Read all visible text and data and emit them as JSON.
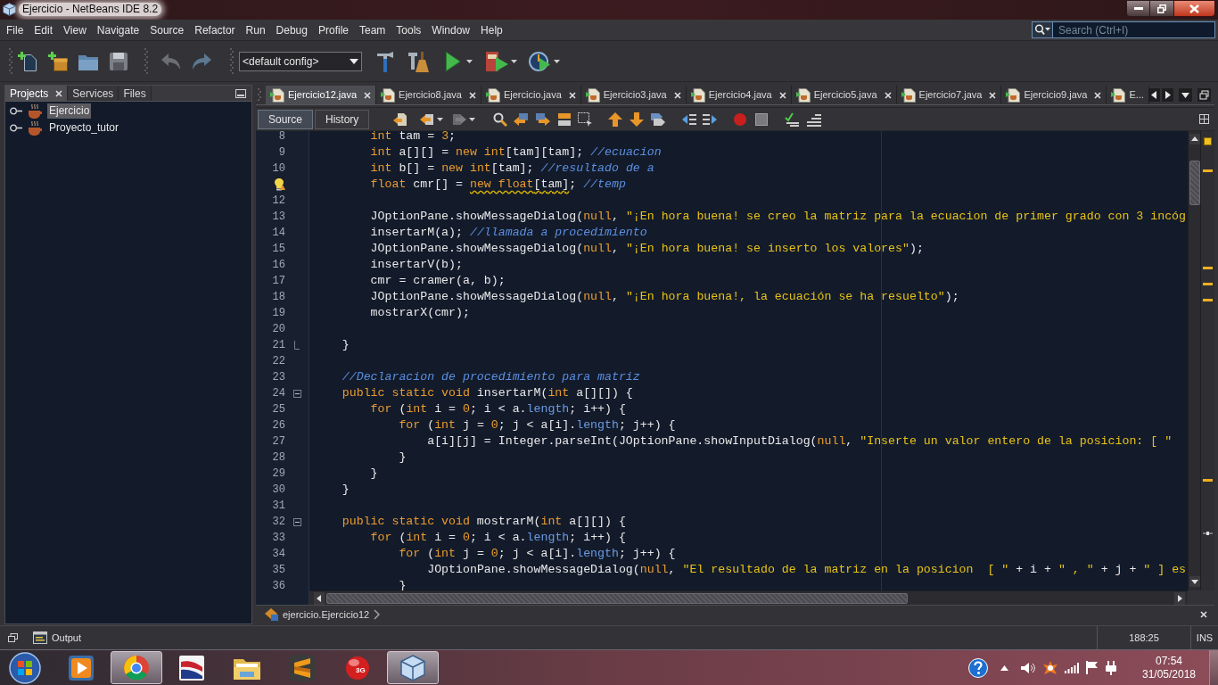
{
  "window": {
    "title": "Ejercicio - NetBeans IDE 8.2"
  },
  "menu_bar": {
    "items": [
      "File",
      "Edit",
      "View",
      "Navigate",
      "Source",
      "Refactor",
      "Run",
      "Debug",
      "Profile",
      "Team",
      "Tools",
      "Window",
      "Help"
    ],
    "search": {
      "placeholder": "Search (Ctrl+I)"
    }
  },
  "toolbar": {
    "config": "<default config>"
  },
  "projects_panel": {
    "tabs": [
      {
        "label": "Projects",
        "selected": true,
        "closable": true
      },
      {
        "label": "Services",
        "selected": false,
        "closable": false
      },
      {
        "label": "Files",
        "selected": false,
        "closable": false
      }
    ],
    "tree": [
      {
        "label": "Ejercicio",
        "selected": true
      },
      {
        "label": "Proyecto_tutor",
        "selected": false
      }
    ]
  },
  "editor": {
    "tabs": [
      {
        "label": "Ejercicio12.java",
        "selected": true,
        "closable": true
      },
      {
        "label": "Ejercicio8.java",
        "selected": false,
        "closable": true
      },
      {
        "label": "Ejercicio.java",
        "selected": false,
        "closable": true
      },
      {
        "label": "Ejercicio3.java",
        "selected": false,
        "closable": true
      },
      {
        "label": "Ejercicio4.java",
        "selected": false,
        "closable": true
      },
      {
        "label": "Ejercicio5.java",
        "selected": false,
        "closable": true
      },
      {
        "label": "Ejercicio7.java",
        "selected": false,
        "closable": true
      },
      {
        "label": "Ejercicio9.java",
        "selected": false,
        "closable": true
      },
      {
        "label": "E...",
        "selected": false,
        "closable": false
      }
    ],
    "views": [
      {
        "label": "Source",
        "selected": true
      },
      {
        "label": "History",
        "selected": false
      }
    ],
    "lines": [
      {
        "number": "8",
        "tokens": [
          {
            "kind": "keyword",
            "text": "        int"
          },
          {
            "kind": "plain",
            "text": " tam = "
          },
          {
            "kind": "number",
            "text": "3"
          },
          {
            "kind": "plain",
            "text": ";"
          }
        ]
      },
      {
        "number": "9",
        "tokens": [
          {
            "kind": "keyword",
            "text": "        int"
          },
          {
            "kind": "plain",
            "text": " a[][] = "
          },
          {
            "kind": "keyword",
            "text": "new int"
          },
          {
            "kind": "plain",
            "text": "[tam][tam]; "
          },
          {
            "kind": "comment",
            "text": "//ecuacion"
          }
        ]
      },
      {
        "number": "10",
        "tokens": [
          {
            "kind": "keyword",
            "text": "        int"
          },
          {
            "kind": "plain",
            "text": " b[] = "
          },
          {
            "kind": "keyword",
            "text": "new int"
          },
          {
            "kind": "plain",
            "text": "[tam]; "
          },
          {
            "kind": "comment",
            "text": "//resultado de a"
          }
        ]
      },
      {
        "hint": true,
        "tokens": [
          {
            "kind": "keyword",
            "text": "        float"
          },
          {
            "kind": "plain",
            "text": " cmr[] = "
          },
          {
            "kind": "keyword",
            "text": "new float",
            "warning": true
          },
          {
            "kind": "plain",
            "text": "[tam]",
            "warning": true
          },
          {
            "kind": "plain",
            "text": "; "
          },
          {
            "kind": "comment",
            "text": "//temp"
          }
        ]
      },
      {
        "number": "12"
      },
      {
        "number": "13",
        "tokens": [
          {
            "kind": "plain",
            "text": "        JOptionPane.showMessageDialog("
          },
          {
            "kind": "keyword",
            "text": "null"
          },
          {
            "kind": "plain",
            "text": ", "
          },
          {
            "kind": "string",
            "text": "\"¡En hora buena! se creo la matriz para la ecuacion de primer grado con 3 incóg"
          }
        ]
      },
      {
        "number": "14",
        "tokens": [
          {
            "kind": "plain",
            "text": "        insertarM(a); "
          },
          {
            "kind": "comment",
            "text": "//llamada a procedimiento"
          }
        ]
      },
      {
        "number": "15",
        "tokens": [
          {
            "kind": "plain",
            "text": "        JOptionPane.showMessageDialog("
          },
          {
            "kind": "keyword",
            "text": "null"
          },
          {
            "kind": "plain",
            "text": ", "
          },
          {
            "kind": "string",
            "text": "\"¡En hora buena! se inserto los valores\""
          },
          {
            "kind": "plain",
            "text": ");"
          }
        ]
      },
      {
        "number": "16",
        "tokens": [
          {
            "kind": "plain",
            "text": "        insertarV(b);"
          }
        ]
      },
      {
        "number": "17",
        "tokens": [
          {
            "kind": "plain",
            "text": "        cmr = cramer(a, b);"
          }
        ]
      },
      {
        "number": "18",
        "tokens": [
          {
            "kind": "plain",
            "text": "        JOptionPane.showMessageDialog("
          },
          {
            "kind": "keyword",
            "text": "null"
          },
          {
            "kind": "plain",
            "text": ", "
          },
          {
            "kind": "string",
            "text": "\"¡En hora buena!, la ecuación se ha resuelto\""
          },
          {
            "kind": "plain",
            "text": ");"
          }
        ]
      },
      {
        "number": "19",
        "tokens": [
          {
            "kind": "plain",
            "text": "        mostrarX(cmr);"
          }
        ]
      },
      {
        "number": "20"
      },
      {
        "number": "21",
        "fold_end": true,
        "tokens": [
          {
            "kind": "plain",
            "text": "    }"
          }
        ]
      },
      {
        "number": "22"
      },
      {
        "number": "23",
        "tokens": [
          {
            "kind": "comment",
            "text": "    //Declaracion de procedimiento para matriz"
          }
        ]
      },
      {
        "number": "24",
        "expanded": true,
        "tokens": [
          {
            "kind": "keyword",
            "text": "    public static void"
          },
          {
            "kind": "plain",
            "text": " insertarM("
          },
          {
            "kind": "keyword",
            "text": "int"
          },
          {
            "kind": "plain",
            "text": " a[][]) {"
          }
        ]
      },
      {
        "number": "25",
        "tokens": [
          {
            "kind": "keyword",
            "text": "        for"
          },
          {
            "kind": "plain",
            "text": " ("
          },
          {
            "kind": "keyword",
            "text": "int"
          },
          {
            "kind": "plain",
            "text": " i = "
          },
          {
            "kind": "number",
            "text": "0"
          },
          {
            "kind": "plain",
            "text": "; i < a."
          },
          {
            "kind": "field",
            "text": "length"
          },
          {
            "kind": "plain",
            "text": "; i++) {"
          }
        ]
      },
      {
        "number": "26",
        "tokens": [
          {
            "kind": "keyword",
            "text": "            for"
          },
          {
            "kind": "plain",
            "text": " ("
          },
          {
            "kind": "keyword",
            "text": "int"
          },
          {
            "kind": "plain",
            "text": " j = "
          },
          {
            "kind": "number",
            "text": "0"
          },
          {
            "kind": "plain",
            "text": "; j < a[i]."
          },
          {
            "kind": "field",
            "text": "length"
          },
          {
            "kind": "plain",
            "text": "; j++) {"
          }
        ]
      },
      {
        "number": "27",
        "tokens": [
          {
            "kind": "plain",
            "text": "                a[i][j] = Integer.parseInt(JOptionPane.showInputDialog("
          },
          {
            "kind": "keyword",
            "text": "null"
          },
          {
            "kind": "plain",
            "text": ", "
          },
          {
            "kind": "string",
            "text": "\"Inserte un valor entero de la posicion: [ \""
          }
        ]
      },
      {
        "number": "28",
        "tokens": [
          {
            "kind": "plain",
            "text": "            }"
          }
        ]
      },
      {
        "number": "29",
        "tokens": [
          {
            "kind": "plain",
            "text": "        }"
          }
        ]
      },
      {
        "number": "30",
        "tokens": [
          {
            "kind": "plain",
            "text": "    }"
          }
        ]
      },
      {
        "number": "31"
      },
      {
        "number": "32",
        "expanded": true,
        "tokens": [
          {
            "kind": "keyword",
            "text": "    public static void"
          },
          {
            "kind": "plain",
            "text": " mostrarM("
          },
          {
            "kind": "keyword",
            "text": "int"
          },
          {
            "kind": "plain",
            "text": " a[][]) {"
          }
        ]
      },
      {
        "number": "33",
        "tokens": [
          {
            "kind": "keyword",
            "text": "        for"
          },
          {
            "kind": "plain",
            "text": " ("
          },
          {
            "kind": "keyword",
            "text": "int"
          },
          {
            "kind": "plain",
            "text": " i = "
          },
          {
            "kind": "number",
            "text": "0"
          },
          {
            "kind": "plain",
            "text": "; i < a."
          },
          {
            "kind": "field",
            "text": "length"
          },
          {
            "kind": "plain",
            "text": "; i++) {"
          }
        ]
      },
      {
        "number": "34",
        "tokens": [
          {
            "kind": "keyword",
            "text": "            for"
          },
          {
            "kind": "plain",
            "text": " ("
          },
          {
            "kind": "keyword",
            "text": "int"
          },
          {
            "kind": "plain",
            "text": " j = "
          },
          {
            "kind": "number",
            "text": "0"
          },
          {
            "kind": "plain",
            "text": "; j < a[i]."
          },
          {
            "kind": "field",
            "text": "length"
          },
          {
            "kind": "plain",
            "text": "; j++) {"
          }
        ]
      },
      {
        "number": "35",
        "tokens": [
          {
            "kind": "plain",
            "text": "                JOptionPane.showMessageDialog("
          },
          {
            "kind": "keyword",
            "text": "null"
          },
          {
            "kind": "plain",
            "text": ", "
          },
          {
            "kind": "string",
            "text": "\"El resultado de la matriz en la posicion  [ \""
          },
          {
            "kind": "plain",
            "text": " + i + "
          },
          {
            "kind": "string",
            "text": "\" , \""
          },
          {
            "kind": "plain",
            "text": " + j + "
          },
          {
            "kind": "string",
            "text": "\" ] es"
          }
        ]
      },
      {
        "number": "36",
        "tokens": [
          {
            "kind": "plain",
            "text": "            }"
          }
        ]
      }
    ],
    "breadcrumb": "ejercicio.Ejercicio12"
  },
  "status_bar": {
    "output": "Output",
    "caret_position": "188:25",
    "insert_mode": "INS"
  },
  "taskbar": {
    "apps": [
      {
        "selected": false
      },
      {
        "selected": true
      },
      {
        "selected": false
      },
      {
        "selected": false
      },
      {
        "selected": false
      },
      {
        "selected": false,
        "badge": "3G"
      },
      {
        "selected": true
      }
    ],
    "clock": {
      "time": "07:54",
      "date": "31/05/2018"
    }
  }
}
